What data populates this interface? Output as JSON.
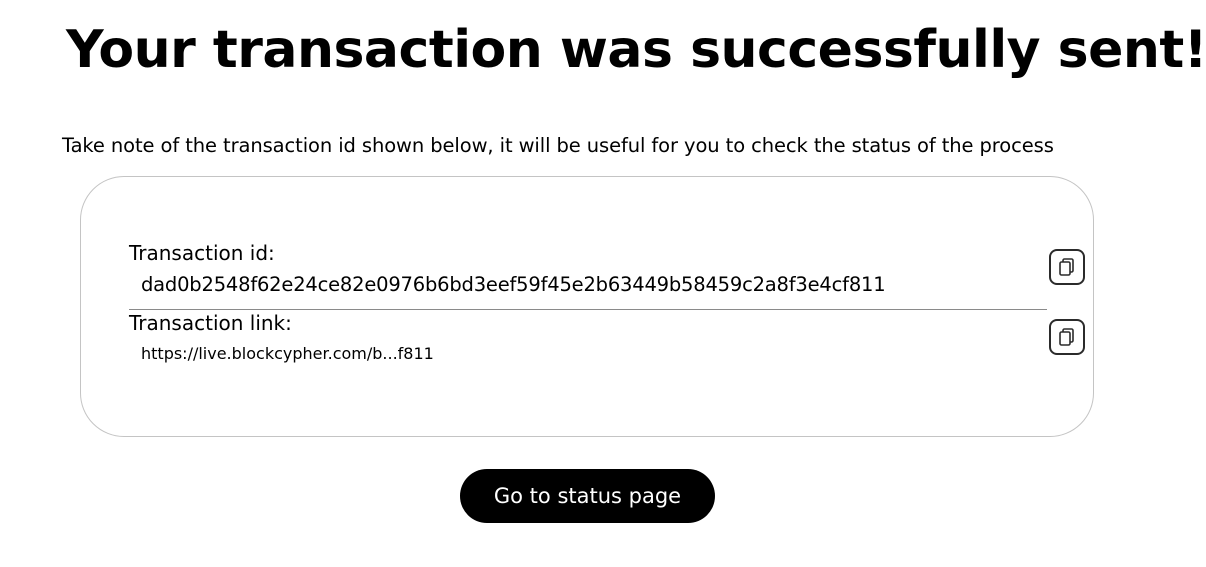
{
  "page": {
    "title": "Your transaction was successfully sent!",
    "subtitle": "Take note of the transaction id shown below, it will be useful for you to check the status of the process"
  },
  "details": {
    "transaction_id": {
      "label": "Transaction id:",
      "value": "dad0b2548f62e24ce82e0976b6bd3eef59f45e2b63449b58459c2a8f3e4cf811",
      "copy_icon": "copy-icon"
    },
    "transaction_link": {
      "label": "Transaction link:",
      "value": "https://live.blockcypher.com/b...f811",
      "copy_icon": "copy-icon"
    }
  },
  "actions": {
    "status_button_label": "Go to status page"
  }
}
